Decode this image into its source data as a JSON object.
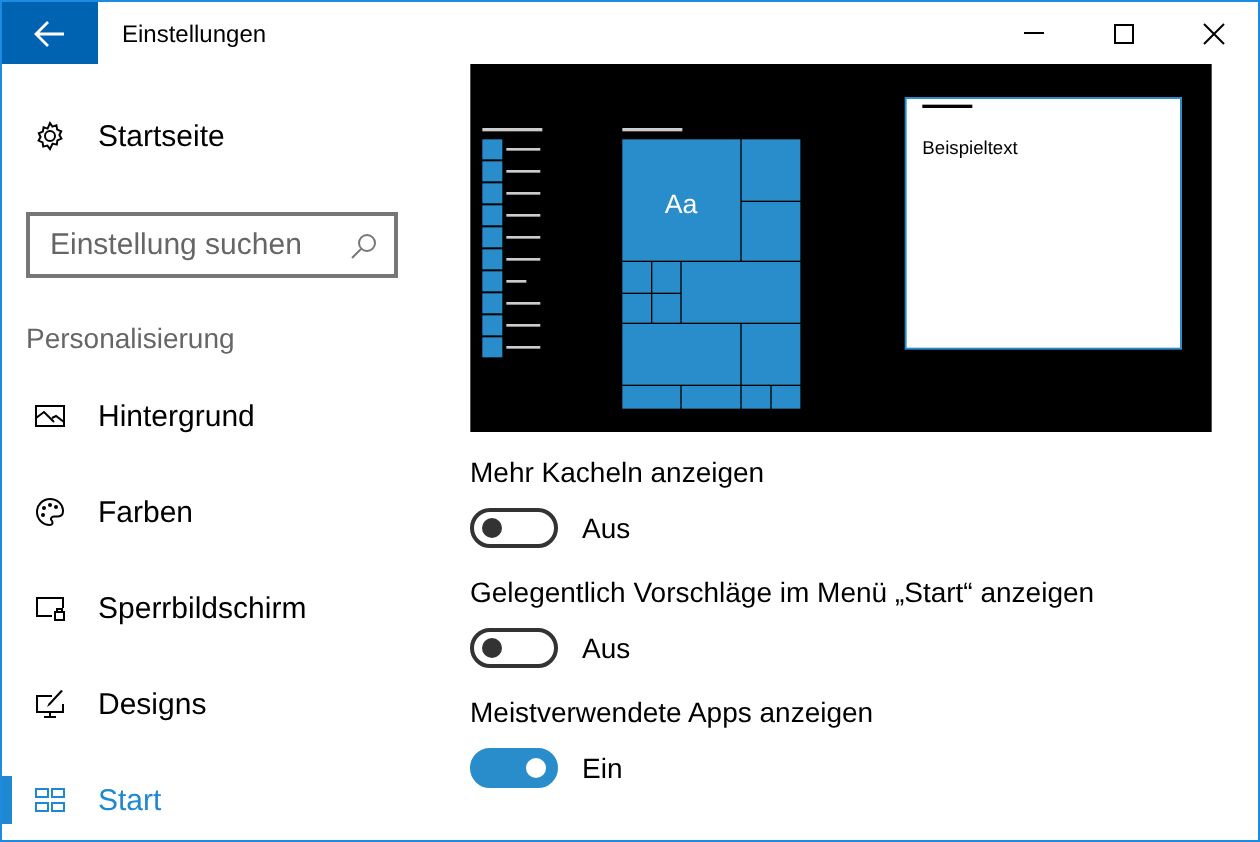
{
  "window": {
    "title": "Einstellungen"
  },
  "sidebar": {
    "home": "Startseite",
    "search": {
      "placeholder": "Einstellung suchen"
    },
    "section": "Personalisierung",
    "items": [
      {
        "label": "Hintergrund",
        "selected": false
      },
      {
        "label": "Farben",
        "selected": false
      },
      {
        "label": "Sperrbildschirm",
        "selected": false
      },
      {
        "label": "Designs",
        "selected": false
      },
      {
        "label": "Start",
        "selected": true
      }
    ]
  },
  "preview": {
    "tile_text": "Aa",
    "sample_text": "Beispieltext"
  },
  "settings": [
    {
      "label": "Mehr Kacheln anzeigen",
      "on": false,
      "state": "Aus"
    },
    {
      "label": "Gelegentlich Vorschläge im Menü „Start“ anzeigen",
      "on": false,
      "state": "Aus"
    },
    {
      "label": "Meistverwendete Apps anzeigen",
      "on": true,
      "state": "Ein"
    }
  ]
}
